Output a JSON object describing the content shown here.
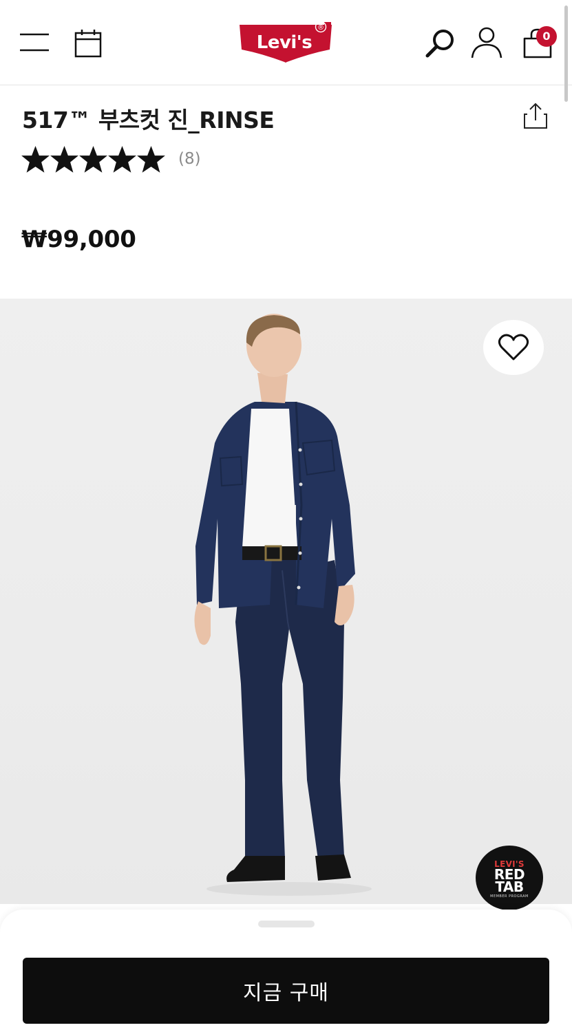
{
  "header": {
    "logo_text": "Levi's",
    "logo_mark": "®",
    "icons": [
      "menu-icon",
      "calendar-icon",
      "search-icon",
      "account-icon",
      "bag-icon"
    ],
    "cart_count": "0",
    "brand_color": "#c41230"
  },
  "product": {
    "title": "517™ 부츠컷 진_RINSE",
    "rating": 5,
    "rating_max": 5,
    "review_count": "(8)",
    "price": "₩99,000"
  },
  "image": {
    "wishlist_icon": "heart-icon",
    "badge": {
      "line1": "LEVI'S",
      "line2": "RED",
      "line3": "TAB",
      "line4": "MEMBER PROGRAM"
    }
  },
  "bottom_bar": {
    "buy_label": "지금 구매"
  }
}
